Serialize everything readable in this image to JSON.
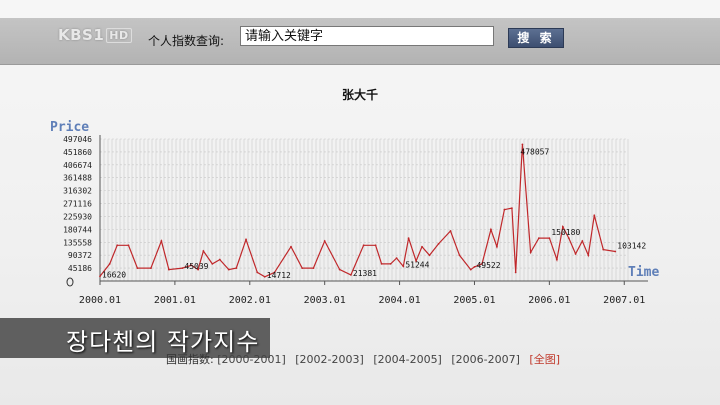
{
  "broadcast_logo": {
    "text": "KBS1",
    "hd": "HD"
  },
  "search": {
    "label": "个人指数查询:",
    "input_value": "请输入关键字",
    "button_label": "搜 索"
  },
  "chart_title": "张大千",
  "caption": "장다첸의 작가지수",
  "range_links": {
    "prefix": "国画指数:",
    "items": [
      "[2000-2001]",
      "[2002-2003]",
      "[2004-2005]",
      "[2006-2007]"
    ],
    "active": "[全图]"
  },
  "colors": {
    "line": "#c0282b",
    "axis_label": "#5f7fb8",
    "grid": "#c8c8c8"
  },
  "chart_data": {
    "type": "line",
    "ylabel": "Price",
    "xlabel": "Time",
    "y_ticks": [
      0,
      45186,
      90372,
      135558,
      180744,
      225930,
      271116,
      316302,
      361488,
      406674,
      451860,
      497046
    ],
    "y_tick_labels": [
      "0",
      "45186",
      "90372",
      "135558",
      "180744",
      "225930",
      "271116",
      "316302",
      "361488",
      "406674",
      "451860",
      "497046"
    ],
    "ylim": [
      0,
      497046
    ],
    "x_ticks": [
      2000.0,
      2001.0,
      2002.0,
      2003.0,
      2004.0,
      2005.0,
      2006.0,
      2007.0
    ],
    "x_tick_labels": [
      "2000.01",
      "2001.01",
      "2002.01",
      "2003.01",
      "2004.01",
      "2005.01",
      "2006.01",
      "2007.01"
    ],
    "xlim": [
      2000.0,
      2007.05
    ],
    "series": [
      {
        "values": [
          [
            2000.0,
            16620
          ],
          [
            2000.13,
            60000
          ],
          [
            2000.23,
            125000
          ],
          [
            2000.38,
            125000
          ],
          [
            2000.5,
            45000
          ],
          [
            2000.68,
            45000
          ],
          [
            2000.82,
            140000
          ],
          [
            2000.92,
            40000
          ],
          [
            2001.1,
            45000
          ],
          [
            2001.22,
            55000
          ],
          [
            2001.31,
            40000
          ],
          [
            2001.38,
            105000
          ],
          [
            2001.5,
            60000
          ],
          [
            2001.6,
            75000
          ],
          [
            2001.72,
            40000
          ],
          [
            2001.82,
            45000
          ],
          [
            2001.95,
            145000
          ],
          [
            2002.1,
            30000
          ],
          [
            2002.2,
            14712
          ],
          [
            2002.33,
            30000
          ],
          [
            2002.55,
            120000
          ],
          [
            2002.7,
            45000
          ],
          [
            2002.85,
            45000
          ],
          [
            2003.0,
            140000
          ],
          [
            2003.2,
            40000
          ],
          [
            2003.35,
            21381
          ],
          [
            2003.52,
            125000
          ],
          [
            2003.68,
            125000
          ],
          [
            2003.76,
            60000
          ],
          [
            2003.88,
            60000
          ],
          [
            2003.96,
            80000
          ],
          [
            2004.05,
            51244
          ],
          [
            2004.12,
            150000
          ],
          [
            2004.22,
            70000
          ],
          [
            2004.3,
            120000
          ],
          [
            2004.4,
            90000
          ],
          [
            2004.52,
            130000
          ],
          [
            2004.68,
            175000
          ],
          [
            2004.8,
            90000
          ],
          [
            2004.95,
            40000
          ],
          [
            2005.0,
            49522
          ],
          [
            2005.1,
            60000
          ],
          [
            2005.22,
            180000
          ],
          [
            2005.3,
            120000
          ],
          [
            2005.4,
            250000
          ],
          [
            2005.5,
            255000
          ],
          [
            2005.55,
            30000
          ],
          [
            2005.64,
            478057
          ],
          [
            2005.75,
            100000
          ],
          [
            2005.86,
            150000
          ],
          [
            2006.0,
            150000
          ],
          [
            2006.1,
            75000
          ],
          [
            2006.18,
            190000
          ],
          [
            2006.26,
            150000
          ],
          [
            2006.35,
            95000
          ],
          [
            2006.44,
            140000
          ],
          [
            2006.52,
            90000
          ],
          [
            2006.6,
            230000
          ],
          [
            2006.72,
            110000
          ],
          [
            2006.88,
            103142
          ]
        ]
      }
    ],
    "data_labels": [
      {
        "x": 2000.0,
        "y": 16620,
        "text": "16620"
      },
      {
        "x": 2001.1,
        "y": 45000,
        "text": "45039"
      },
      {
        "x": 2002.2,
        "y": 14712,
        "text": "14712"
      },
      {
        "x": 2003.35,
        "y": 21381,
        "text": "21381"
      },
      {
        "x": 2004.05,
        "y": 51244,
        "text": "51244"
      },
      {
        "x": 2005.0,
        "y": 49522,
        "text": "49522"
      },
      {
        "x": 2005.64,
        "y": 478057,
        "text": "478057"
      },
      {
        "x": 2006.0,
        "y": 150000,
        "text": "150180"
      },
      {
        "x": 2006.88,
        "y": 103142,
        "text": "103142"
      }
    ],
    "grid": true
  }
}
